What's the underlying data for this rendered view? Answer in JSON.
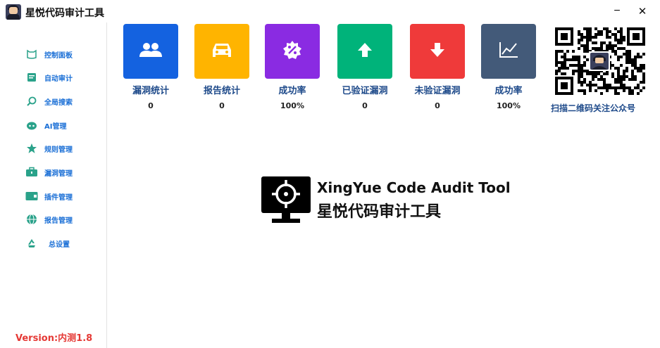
{
  "window": {
    "title": "星悦代码审计工具",
    "minimize_glyph": "−",
    "close_glyph": "✕",
    "app_icon": "hacker-avatar-icon"
  },
  "sidebar": {
    "items": [
      {
        "label": "控制面板",
        "icon": "cat-face-icon"
      },
      {
        "label": "自动审计",
        "icon": "document-icon"
      },
      {
        "label": "全局搜索",
        "icon": "search-icon"
      },
      {
        "label": "AI管理",
        "icon": "robot-icon"
      },
      {
        "label": "规则管理",
        "icon": "star-icon"
      },
      {
        "label": "漏洞管理",
        "icon": "briefcase-icon"
      },
      {
        "label": "插件管理",
        "icon": "card-icon"
      },
      {
        "label": "报告管理",
        "icon": "globe-icon"
      },
      {
        "label": "总设置",
        "icon": "recycle-icon"
      }
    ],
    "version": "Version:内测1.8"
  },
  "stats": [
    {
      "label": "漏洞统计",
      "value": "0",
      "color": "#1462e0",
      "icon": "users-icon"
    },
    {
      "label": "报告统计",
      "value": "0",
      "color": "#ffb400",
      "icon": "car-icon"
    },
    {
      "label": "成功率",
      "value": "100%",
      "color": "#8a2be2",
      "icon": "percent-badge-icon"
    },
    {
      "label": "已验证漏洞",
      "value": "0",
      "color": "#00b37a",
      "icon": "arrow-up-icon"
    },
    {
      "label": "未验证漏洞",
      "value": "0",
      "color": "#ef3a3a",
      "icon": "arrow-down-icon"
    },
    {
      "label": "成功率",
      "value": "100%",
      "color": "#435a79",
      "icon": "line-chart-icon"
    }
  ],
  "qr": {
    "caption": "扫描二维码关注公众号"
  },
  "hero": {
    "title_en": "XingYue Code Audit Tool",
    "title_cn": "星悦代码审计工具",
    "logo": "monitor-crosshair-icon"
  },
  "colors": {
    "nav_text": "#1a6fd6",
    "nav_icon": "#2aa28a",
    "label_text": "#1e4a8a",
    "version_text": "#e53935"
  }
}
